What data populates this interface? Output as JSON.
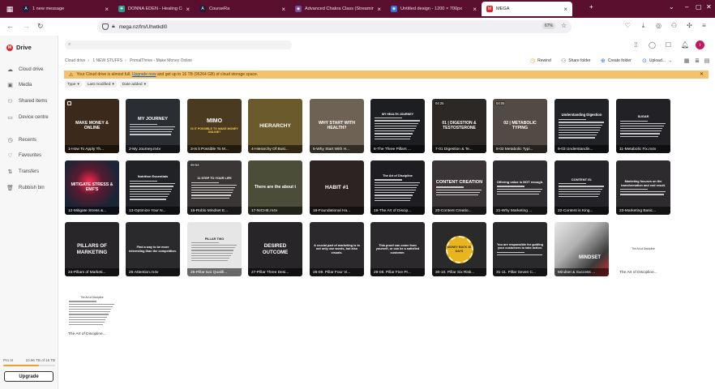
{
  "tabs": [
    {
      "title": "1 new message",
      "favicon_color": "#1e1e3c",
      "favicon_letter": "A"
    },
    {
      "title": "DONNA EDEN - Healing Course",
      "favicon_color": "#2a9d8f",
      "favicon_letter": "✚"
    },
    {
      "title": "CourseRa",
      "favicon_color": "#1e1e3c",
      "favicon_letter": "A"
    },
    {
      "title": "Advanced Chakra Class (Streaming Vi",
      "favicon_color": "#7a4c9a",
      "favicon_letter": "◆"
    },
    {
      "title": "Untitled design - 1200 × 700px",
      "favicon_color": "#2f6fde",
      "favicon_letter": "◉"
    },
    {
      "title": "MEGA",
      "favicon_color": "#d9272e",
      "favicon_letter": "M"
    }
  ],
  "url": "mega.nz/fm/Uhwtkdl0",
  "zoom": "67%",
  "sidebar": {
    "brand": "Drive",
    "items": [
      {
        "label": "Cloud drive",
        "icon": "cloud-icon"
      },
      {
        "label": "Media",
        "icon": "media-icon"
      },
      {
        "label": "Shared items",
        "icon": "shared-icon"
      },
      {
        "label": "Device centre",
        "icon": "device-icon"
      },
      {
        "label": "Recents",
        "icon": "clock-icon"
      },
      {
        "label": "Favourites",
        "icon": "heart-icon"
      },
      {
        "label": "Transfers",
        "icon": "transfer-icon"
      },
      {
        "label": "Rubbish bin",
        "icon": "trash-icon"
      }
    ],
    "plan": "Pro III",
    "storage": "10.96 TB of 16 TB",
    "storage_fraction": 0.68,
    "upgrade_label": "Upgrade"
  },
  "search_placeholder": "",
  "breadcrumbs": [
    "Cloud drive",
    "1 NEW STUFFS",
    "PrimalThrive - Make Money Online"
  ],
  "actions": {
    "rewind": "Rewind",
    "share": "Share folder",
    "create": "Create folder",
    "upload": "Upload..."
  },
  "warning": {
    "prefix": "Your Cloud drive is almost full.",
    "link": "Upgrade now",
    "suffix": "and get up to 16 TB (95264 GB) of cloud storage space."
  },
  "filters": [
    "Type",
    "Last modified",
    "Date added"
  ],
  "files": [
    {
      "name": "1-How To Apply Th...",
      "duration": "",
      "bg": "#3b2a1c",
      "text": "MAKE MONEY & ONLINE",
      "text_color": "#ffffff",
      "size": 5.2
    },
    {
      "name": "2-My Journey.m4v",
      "duration": "",
      "bg": "#2a2e33",
      "text": "MY JOURNEY",
      "text_color": "#ffffff",
      "size": 5.6,
      "lines": 5
    },
    {
      "name": "3-Is it Possible To M...",
      "duration": "",
      "bg": "#4a3a20",
      "text": "MIMO",
      "text_color": "#ffffff",
      "size": 7,
      "sub": "IS IT POSSIBLE TO MAKE MONEY ONLINE?",
      "sub_color": "#f2d04a"
    },
    {
      "name": "4-Hierarchy Of Busi...",
      "duration": "",
      "bg": "#6a5a2c",
      "text": "HIERARCHY",
      "text_color": "#ffffff",
      "size": 6.5
    },
    {
      "name": "5-Why Start With H...",
      "duration": "",
      "bg": "#6d6254",
      "text": "WHY START WITH HEALTH?",
      "text_color": "#ffffff",
      "size": 5.2
    },
    {
      "name": "6-The Three Pillars ...",
      "duration": "",
      "bg": "#1c1e22",
      "text": "MY HEALTH JOURNEY",
      "text_color": "#ffffff",
      "size": 3.6,
      "lines": 9
    },
    {
      "name": "7-01 Digestion & Te...",
      "duration": "04:25",
      "bg": "#2c2826",
      "text": "01 | DIGESTION & TESTOSTERONE",
      "text_color": "#ffffff",
      "size": 5
    },
    {
      "name": "8-02 Metabolic Typi...",
      "duration": "04:05",
      "bg": "#524a43",
      "text": "02 | METABOLIC TYPING",
      "text_color": "#ffffff",
      "size": 5.2
    },
    {
      "name": "9-03 Understandin...",
      "duration": "",
      "bg": "#202226",
      "text": "Understanding Digestion",
      "text_color": "#ffffff",
      "size": 4.2,
      "lines": 8
    },
    {
      "name": "11-Metabolic Fix.m4v",
      "duration": "",
      "bg": "#222226",
      "text": "SUGAR",
      "text_color": "#ffffff",
      "size": 3.8,
      "lines": 7
    },
    {
      "name": "12-Mitigate Stress &...",
      "duration": "",
      "bg": "#1a2536",
      "text": "MITIGATE STRESS & EMF'S",
      "text_color": "#ffffff",
      "size": 5.2,
      "glow": "#ff2a4d"
    },
    {
      "name": "13-Optimize Your N...",
      "duration": "",
      "bg": "#202226",
      "text": "Nutrition Essentials",
      "text_color": "#ffffff",
      "size": 4,
      "lines": 8
    },
    {
      "name": "15-Roblo Mindset E...",
      "duration": "08:53",
      "bg": "#3a3636",
      "text": "11 STEP TO YOUR LIFE",
      "text_color": "#ffffff",
      "size": 3.8,
      "lines": 7
    },
    {
      "name": "17-NICHE.m4v",
      "duration": "",
      "bg": "#4b4d38",
      "text": "There are the about t",
      "text_color": "#ffffff",
      "size": 5.2
    },
    {
      "name": "18-Foundational Ha...",
      "duration": "",
      "bg": "#2b2422",
      "text": "HABIT #1",
      "text_color": "#ffffff",
      "size": 6.5
    },
    {
      "name": "19-The Art of Discip...",
      "duration": "",
      "bg": "#1e1e22",
      "text": "The Art of Discipline",
      "text_color": "#ffffff",
      "size": 3.8,
      "lines": 9
    },
    {
      "name": "20-Content Creatio...",
      "duration": "",
      "bg": "#3a3436",
      "text": "CONTENT CREATION",
      "text_color": "#ffffff",
      "size": 5.6,
      "lines": 4
    },
    {
      "name": "21-Why Marketing ...",
      "duration": "",
      "bg": "#2f2d2f",
      "text": "Offering value is NOT enough.",
      "text_color": "#ffffff",
      "size": 4,
      "lines": 4
    },
    {
      "name": "22-Content is King...",
      "duration": "",
      "bg": "#242428",
      "text": "CONTENT IS:",
      "text_color": "#ffffff",
      "size": 4,
      "lines": 6
    },
    {
      "name": "23-Marketing Basic...",
      "duration": "",
      "bg": "#2d2b2d",
      "text": "Marketing focuses on the transformation and end result.",
      "text_color": "#ffffff",
      "size": 3.8,
      "lines": 3
    },
    {
      "name": "24-Pillars of Marketi...",
      "duration": "",
      "bg": "#282628",
      "text": "PILLARS OF MARKETING",
      "text_color": "#ffffff",
      "size": 6.2
    },
    {
      "name": "25-Attention.m4v",
      "duration": "",
      "bg": "#2a2a2c",
      "text": "Find a way to be more interesting than the competition.",
      "text_color": "#ffffff",
      "size": 3.8
    },
    {
      "name": "26-Pillar two Qualifi...",
      "duration": "",
      "bg": "#e6e6e6",
      "text": "PILLAR TWO",
      "text_color": "#222222",
      "size": 3.8,
      "lines": 8,
      "dark_lines": true
    },
    {
      "name": "27-Pillar Three Desi...",
      "duration": "",
      "bg": "#272527",
      "text": "DESIRED OUTCOME",
      "text_color": "#ffffff",
      "size": 6.2
    },
    {
      "name": "28-09. Pillar Four Vi...",
      "duration": "",
      "bg": "#2b292b",
      "text": "A crucial part of marketing is to not only use words, but also visuals.",
      "text_color": "#ffffff",
      "size": 3.8
    },
    {
      "name": "29-08. Pillar Five Pr...",
      "duration": "",
      "bg": "#2b292b",
      "text": "This proof can come from yourself, or can be a satisfied customer.",
      "text_color": "#ffffff",
      "size": 3.8
    },
    {
      "name": "30-10. Pillar Six Risk...",
      "duration": "",
      "bg": "#2b2a2a",
      "text": "MONEY BACK 30 DAYS",
      "text_color": "#3a2a00",
      "size": 3.6,
      "badge": "#e8b520"
    },
    {
      "name": "31-11. Pillar Seven C...",
      "duration": "",
      "bg": "#2a2a2c",
      "text": "You are responsible for guiding your customers to take action.",
      "text_color": "#ffffff",
      "size": 3.8,
      "lines": 2
    },
    {
      "name": "Mindset & Success ...",
      "duration": "",
      "bg": "#f4f4f4",
      "text": "MINDSET",
      "text_color": "#ffffff",
      "size": 6,
      "mindset": true
    },
    {
      "name": "The Art of Discipline...",
      "duration": "",
      "bg": "#ffffff",
      "text": "The Art of Discipline",
      "text_color": "#333333",
      "size": 3.2,
      "doc": true
    },
    {
      "name": "The Art of Discipline...",
      "duration": "",
      "bg": "#ffffff",
      "text": "The Art of Discipline",
      "text_color": "#333333",
      "size": 3.2,
      "doc": true,
      "lines": 10,
      "dark_lines": true
    }
  ]
}
